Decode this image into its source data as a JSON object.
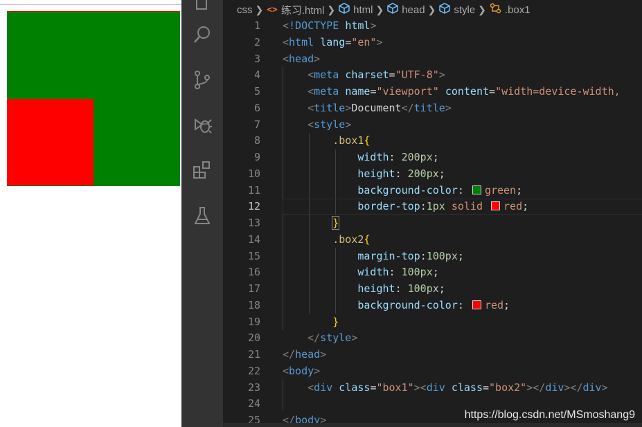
{
  "breadcrumb": [
    {
      "label": "css",
      "icon": null
    },
    {
      "label": "练习.html",
      "icon": "html-file-icon"
    },
    {
      "label": "html",
      "icon": "element-cube-icon"
    },
    {
      "label": "head",
      "icon": "element-cube-icon"
    },
    {
      "label": "style",
      "icon": "element-cube-icon"
    },
    {
      "label": ".box1",
      "icon": "css-selector-icon"
    }
  ],
  "activity_bar": {
    "icons": [
      "search-icon",
      "source-control-icon",
      "debug-icon",
      "extensions-icon",
      "testing-flask-icon"
    ]
  },
  "editor": {
    "current_line": 12,
    "line_numbers": [
      "1",
      "2",
      "3",
      "4",
      "5",
      "6",
      "7",
      "8",
      "9",
      "10",
      "11",
      "12",
      "13",
      "14",
      "15",
      "16",
      "17",
      "18",
      "19",
      "20",
      "21",
      "22",
      "23",
      "24",
      "25"
    ]
  },
  "colors": {
    "box1_background": "#008000",
    "box2_background": "#ff0000",
    "swatch_green": "#008000",
    "swatch_red": "#ff0000"
  },
  "watermark": "https://blog.csdn.net/MSmoshang9"
}
